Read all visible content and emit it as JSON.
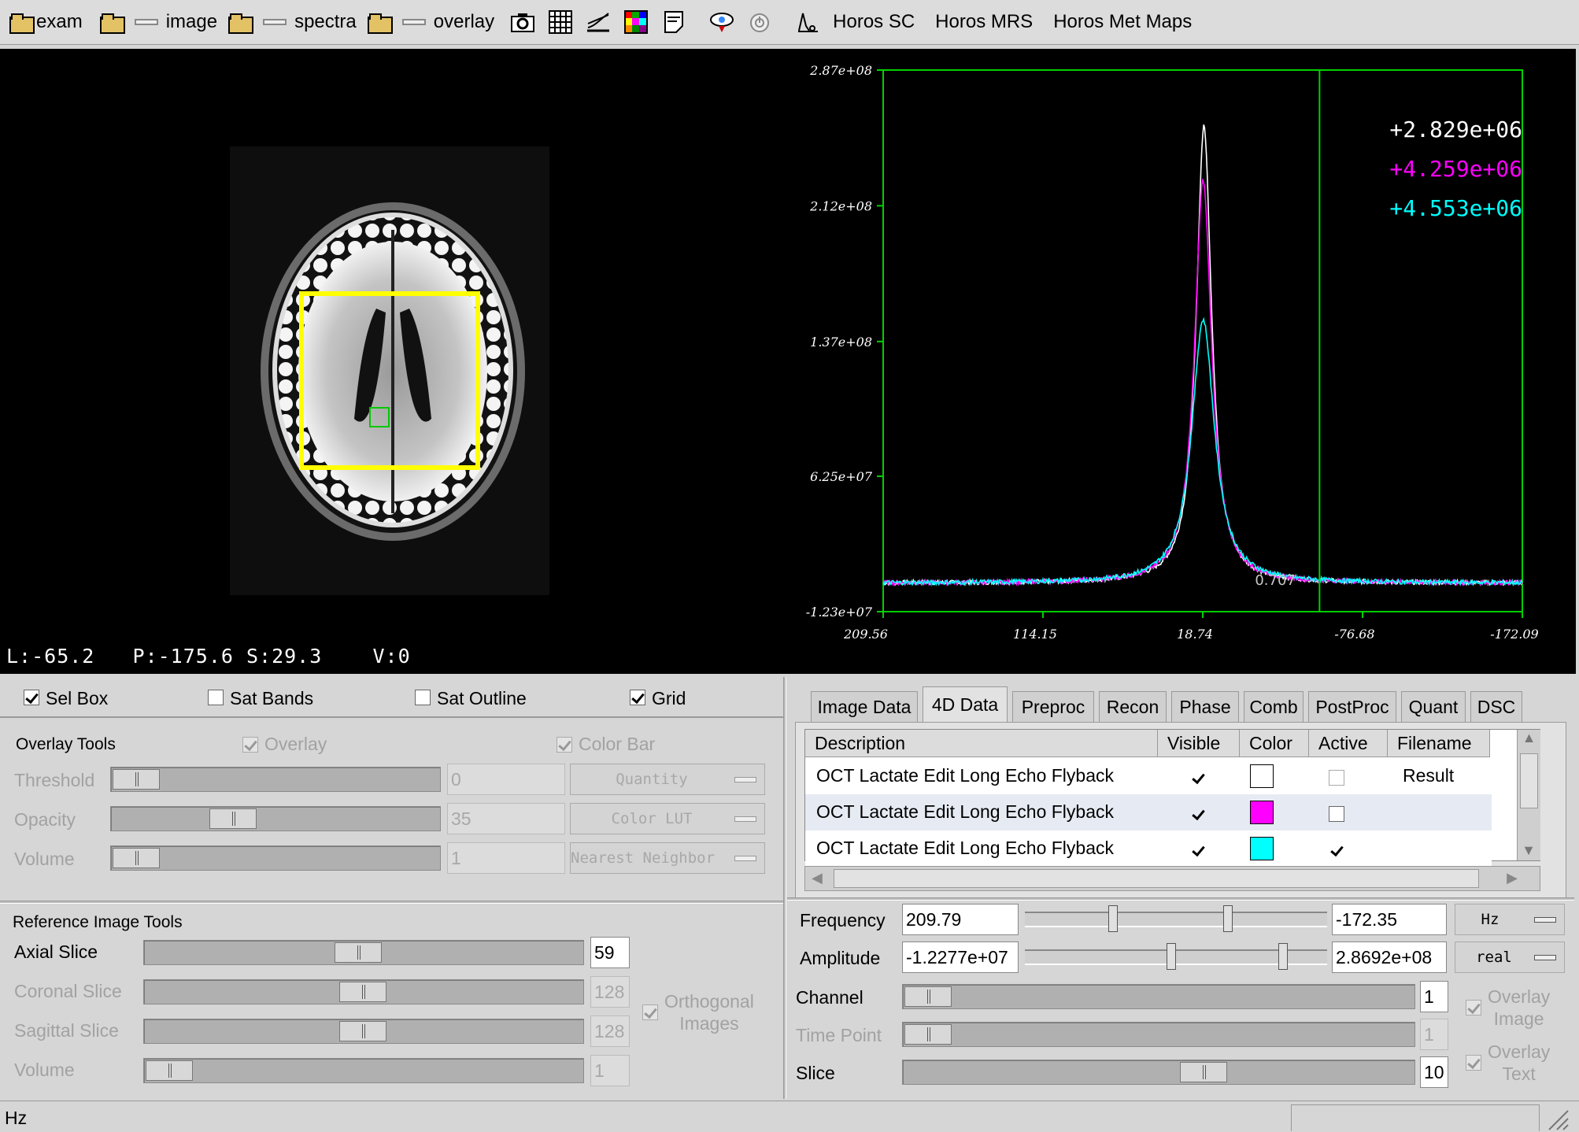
{
  "toolbar": {
    "exam_label": "exam",
    "image_label": "image",
    "spectra_label": "spectra",
    "overlay_label": "overlay",
    "links": [
      "Horos SC",
      "Horos MRS",
      "Horos Met Maps"
    ]
  },
  "viewer": {
    "coords": "L:-65.2   P:-175.6 S:29.3    V:0"
  },
  "chart_data": {
    "type": "line",
    "title": "",
    "xlabel": "",
    "ylabel": "",
    "x_ticks": [
      "209.56",
      "114.15",
      "18.74",
      "-76.68",
      "-172.09"
    ],
    "y_ticks": [
      "2.87e+08",
      "2.12e+08",
      "1.37e+08",
      "6.25e+07",
      "-1.23e+07"
    ],
    "xlim": [
      209.56,
      -172.09
    ],
    "ylim": [
      -12300000,
      287000000
    ],
    "cursor_x": -51,
    "cursor_label": "0.707",
    "grid": false,
    "legend_values": [
      "+2.829e+06",
      "+4.259e+06",
      "+4.553e+06"
    ],
    "series": [
      {
        "color": "#ffffff",
        "peak_x": 18.0,
        "peak_y": 256000000,
        "width": 5.6,
        "baseline": 3500000
      },
      {
        "color": "#ff00ff",
        "peak_x": 18.5,
        "peak_y": 226000000,
        "width": 6.2,
        "baseline": 3500000
      },
      {
        "color": "#00ffff",
        "peak_x": 18.5,
        "peak_y": 149000000,
        "width": 8.2,
        "baseline": 3500000
      }
    ]
  },
  "viewer_options": {
    "sel_box": "Sel Box",
    "sat_bands": "Sat Bands",
    "sat_outline": "Sat Outline",
    "grid": "Grid"
  },
  "overlay_tools": {
    "title": "Overlay Tools",
    "overlay": "Overlay",
    "color_bar": "Color Bar",
    "threshold": "Threshold",
    "threshold_value": "0",
    "quantity": "Quantity",
    "opacity": "Opacity",
    "opacity_value": "35",
    "color_lut": "Color LUT",
    "volume": "Volume",
    "volume_value": "1",
    "interp": "Nearest Neighbor"
  },
  "reference_tools": {
    "title": "Reference Image Tools",
    "axial": "Axial Slice",
    "axial_value": "59",
    "coronal": "Coronal Slice",
    "coronal_value": "128",
    "sagittal": "Sagittal Slice",
    "sagittal_value": "128",
    "volume": "Volume",
    "volume_value": "1",
    "orthogonal": "Orthogonal\nImages"
  },
  "tabs": [
    "Image Data",
    "4D Data",
    "Preproc",
    "Recon",
    "Phase",
    "Comb",
    "PostProc",
    "Quant",
    "DSC"
  ],
  "table": {
    "headers": [
      "Description",
      "Visible",
      "Color",
      "Active",
      "Filename"
    ],
    "rows": [
      {
        "description": "OCT Lactate Edit Long Echo Flyback",
        "visible": true,
        "color": "#ffffff",
        "active": false,
        "filename": "Result"
      },
      {
        "description": "OCT Lactate Edit Long Echo Flyback",
        "visible": true,
        "color": "#ff00ff",
        "active": false,
        "filename": ""
      },
      {
        "description": "OCT Lactate Edit Long Echo Flyback",
        "visible": true,
        "color": "#00ffff",
        "active": true,
        "filename": ""
      }
    ]
  },
  "controls": {
    "frequency": "Frequency",
    "freq_min": "209.79",
    "freq_max": "-172.35",
    "freq_unit": "Hz",
    "amplitude": "Amplitude",
    "amp_min": "-1.2277e+07",
    "amp_max": "2.8692e+08",
    "amp_mode": "real",
    "channel": "Channel",
    "channel_value": "1",
    "time_point": "Time Point",
    "time_value": "1",
    "slice": "Slice",
    "slice_value": "10",
    "overlay_image": "Overlay\nImage",
    "overlay_text": "Overlay\nText"
  },
  "status": {
    "text": "Hz"
  }
}
